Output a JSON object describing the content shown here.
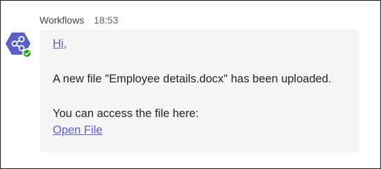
{
  "message": {
    "sender": "Workflows",
    "time": "18:53",
    "greeting": "Hi,",
    "body": "A new file \"Employee details.docx\" has been uploaded.",
    "access_text": "You can access the file here:",
    "link_label": "Open File"
  },
  "avatar": {
    "icon": "share-nodes-icon",
    "status": "available-check-icon",
    "bg_color": "#5b5fc7",
    "status_color": "#13a10e"
  },
  "colors": {
    "link": "#5b5fc7",
    "bubble": "#f5f5f5",
    "text": "#242424",
    "meta": "#616161"
  }
}
